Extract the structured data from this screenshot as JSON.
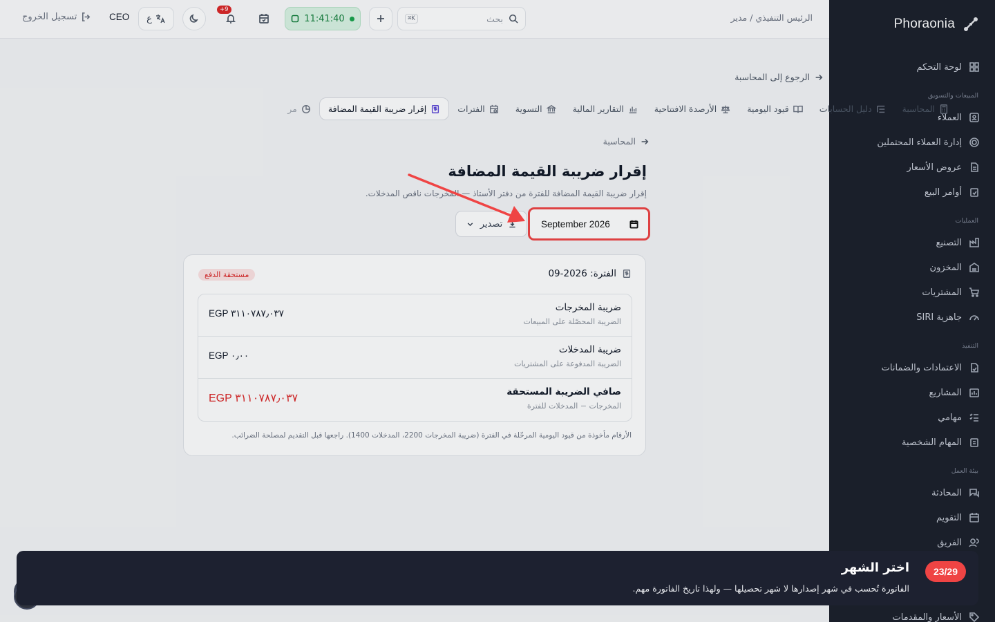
{
  "brand": {
    "name": "Phoraonia"
  },
  "topbar": {
    "role": "الرئيس التنفيذي / مدير",
    "search_placeholder": "بحث",
    "search_shortcut": "K⌘",
    "clock": "11:41:40",
    "notifications_count": "+9",
    "language": "ع",
    "user": "CEO",
    "logout": "تسجيل الخروج"
  },
  "sidebar": {
    "dashboard": "لوحة التحكم",
    "section_sales": "المبيعات والتسويق",
    "clients": "العملاء",
    "leads": "إدارة العملاء المحتملين",
    "quotes": "عروض الأسعار",
    "sales_orders": "أوامر البيع",
    "section_ops": "العمليات",
    "manufacturing": "التصنيع",
    "inventory": "المخزون",
    "purchases": "المشتريات",
    "siri": "جاهزية SIRI",
    "section_exec": "التنفيذ",
    "approvals": "الاعتمادات والضمانات",
    "projects": "المشاريع",
    "tasks": "مهامي",
    "personal_tasks": "المهام الشخصية",
    "section_work": "بيئة العمل",
    "chat": "المحادثة",
    "calendar": "التقويم",
    "team": "الفريق",
    "pricing": "الأسعار والمقدمات"
  },
  "main": {
    "back_to_accounting": "الرجوع إلى المحاسبة",
    "tabs": [
      "المحاسبة",
      "دليل الحسابات",
      "قيود اليومية",
      "الأرصدة الافتتاحية",
      "التقارير المالية",
      "التسوية",
      "الفترات",
      "إقرار ضريبة القيمة المضافة",
      "مر"
    ],
    "breadcrumb": "المحاسبة",
    "title": "إقرار ضريبة القيمة المضافة",
    "description": "إقرار ضريبة القيمة المضافة للفترة من دفتر الأستاذ — المخرجات ناقص المدخلات.",
    "month_value": "September 2026",
    "export_label": "تصدير",
    "card": {
      "period_label": "الفترة: 2026-09",
      "status_badge": "مستحقة الدفع",
      "rows": [
        {
          "label": "ضريبة المخرجات",
          "sub": "الضريبة المحصّلة على المبيعات",
          "amount": "EGP ٣١١٠٧٨٧٫٠٣٧"
        },
        {
          "label": "ضريبة المدخلات",
          "sub": "الضريبة المدفوعة على المشتريات",
          "amount": "EGP ٠٫٠٠"
        },
        {
          "label": "صافي الضريبة المستحقة",
          "sub": "المخرجات − المدخلات للفترة",
          "amount": "EGP ٣١١٠٧٨٧٫٠٣٧"
        }
      ],
      "footnote": "الأرقام مأخوذة من قيود اليومية المرحّلة في الفترة (ضريبة المخرجات 2200، المدخلات 1400). راجعها قبل التقديم لمصلحة الضرائب."
    }
  },
  "tour": {
    "step": "23/29",
    "title": "اختر الشهر",
    "description": "الفاتورة تُحسب في شهر إصدارها لا شهر تحصيلها — ولهذا تاريخ الفاتورة مهم."
  },
  "colors": {
    "accent_red": "#ef4444",
    "sidebar_bg": "#1b1f2a",
    "clock_green": "#16a34a"
  }
}
